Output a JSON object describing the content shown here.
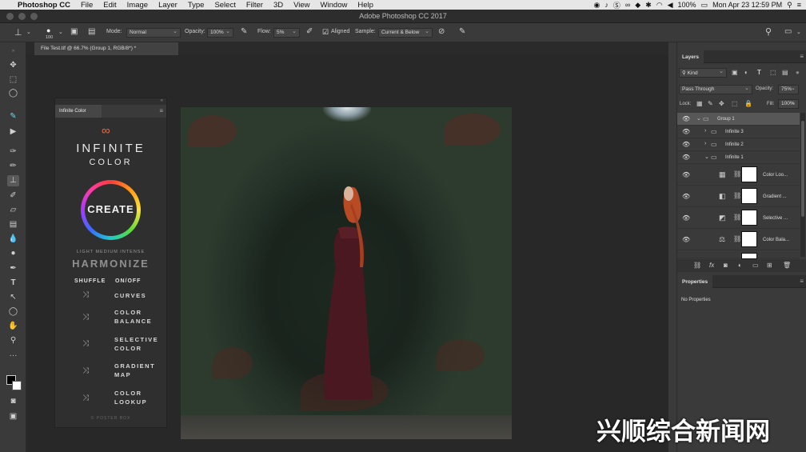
{
  "menubar": {
    "apple_icon": "apple-icon",
    "app_name": "Photoshop CC",
    "items": [
      "File",
      "Edit",
      "Image",
      "Layer",
      "Type",
      "Select",
      "Filter",
      "3D",
      "View",
      "Window",
      "Help"
    ],
    "battery": "100%",
    "datetime": "Mon Apr 23  12:59 PM"
  },
  "window": {
    "title": "Adobe Photoshop CC 2017"
  },
  "options": {
    "brush_size": "100",
    "mode_label": "Mode:",
    "mode_value": "Normal",
    "opacity_label": "Opacity:",
    "opacity_value": "100%",
    "flow_label": "Flow:",
    "flow_value": "5%",
    "aligned_label": "Aligned",
    "sample_label": "Sample:",
    "sample_value": "Current & Below"
  },
  "document": {
    "tab": "File Test.tif @ 66.7% (Group 1, RGB/8*) *"
  },
  "infinite_color": {
    "tab": "Infinite Color",
    "title": "INFINITE",
    "subtitle": "COLOR",
    "create": "CREATE",
    "levels": "LIGHT  MEDIUM  INTENSE",
    "harmonize": "HARMONIZE",
    "shuffle_header": "SHUFFLE",
    "onoff_header": "ON/OFF",
    "rows": [
      "CURVES",
      "COLOR\nBALANCE",
      "SELECTIVE\nCOLOR",
      "GRADIENT\nMAP",
      "COLOR\nLOOKUP"
    ],
    "footer": "© POSTER BOX"
  },
  "layers": {
    "tab": "Layers",
    "filter_kind": "Kind",
    "blend_mode": "Pass Through",
    "opacity_label": "Opacity:",
    "opacity_value": "75%",
    "lock_label": "Lock:",
    "fill_label": "Fill:",
    "fill_value": "100%",
    "items": [
      {
        "name": "Group 1"
      },
      {
        "name": "Infinite 3"
      },
      {
        "name": "Infinite 2"
      },
      {
        "name": "Infinite 1"
      },
      {
        "name": "Color Loo..."
      },
      {
        "name": "Gradient ..."
      },
      {
        "name": "Selective ..."
      },
      {
        "name": "Color Bala..."
      }
    ]
  },
  "properties": {
    "tab": "Properties",
    "empty": "No Properties"
  },
  "watermark": "兴顺综合新闻网"
}
